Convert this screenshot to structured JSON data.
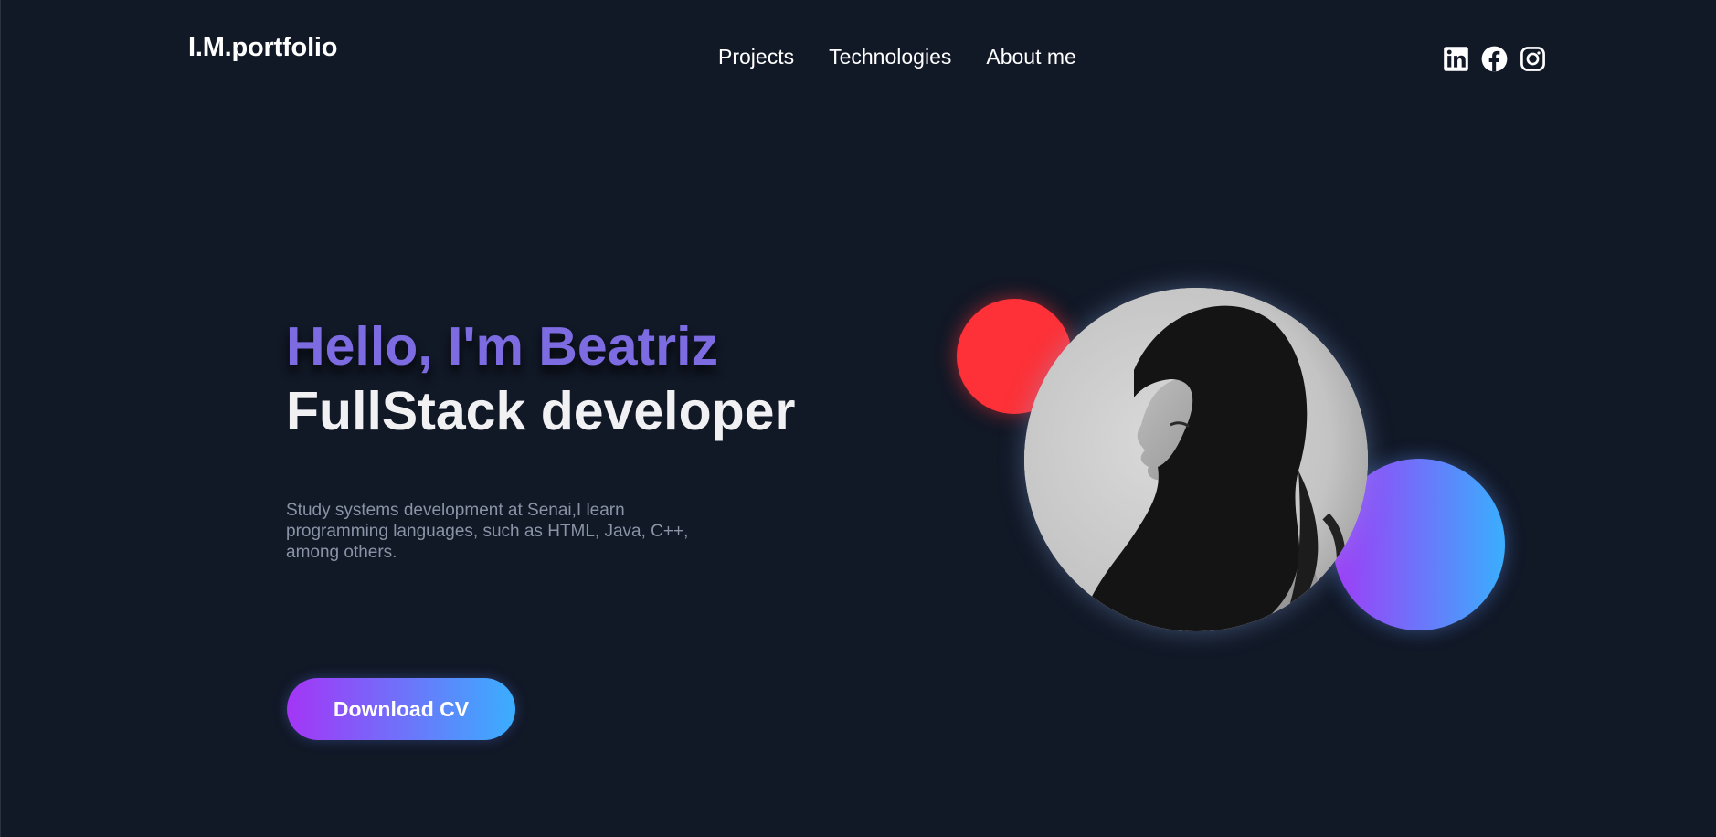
{
  "header": {
    "logo": "I.M.portfolio",
    "nav": [
      {
        "label": "Projects"
      },
      {
        "label": "Technologies"
      },
      {
        "label": "About me"
      }
    ],
    "social": [
      {
        "icon": "linkedin-icon"
      },
      {
        "icon": "facebook-icon"
      },
      {
        "icon": "instagram-icon"
      }
    ]
  },
  "hero": {
    "greeting": "Hello, I'm Beatriz",
    "role": "FullStack developer",
    "description": "Study systems development at Senai,I learn programming languages, such as HTML, Java, C++, among others.",
    "cta": "Download CV"
  },
  "colors": {
    "background": "#111826",
    "greeting": "#7c6be1",
    "accent_red": "#fd3137",
    "gradient_start": "#a435f6",
    "gradient_end": "#3aaefe",
    "description": "#8a94a6"
  }
}
